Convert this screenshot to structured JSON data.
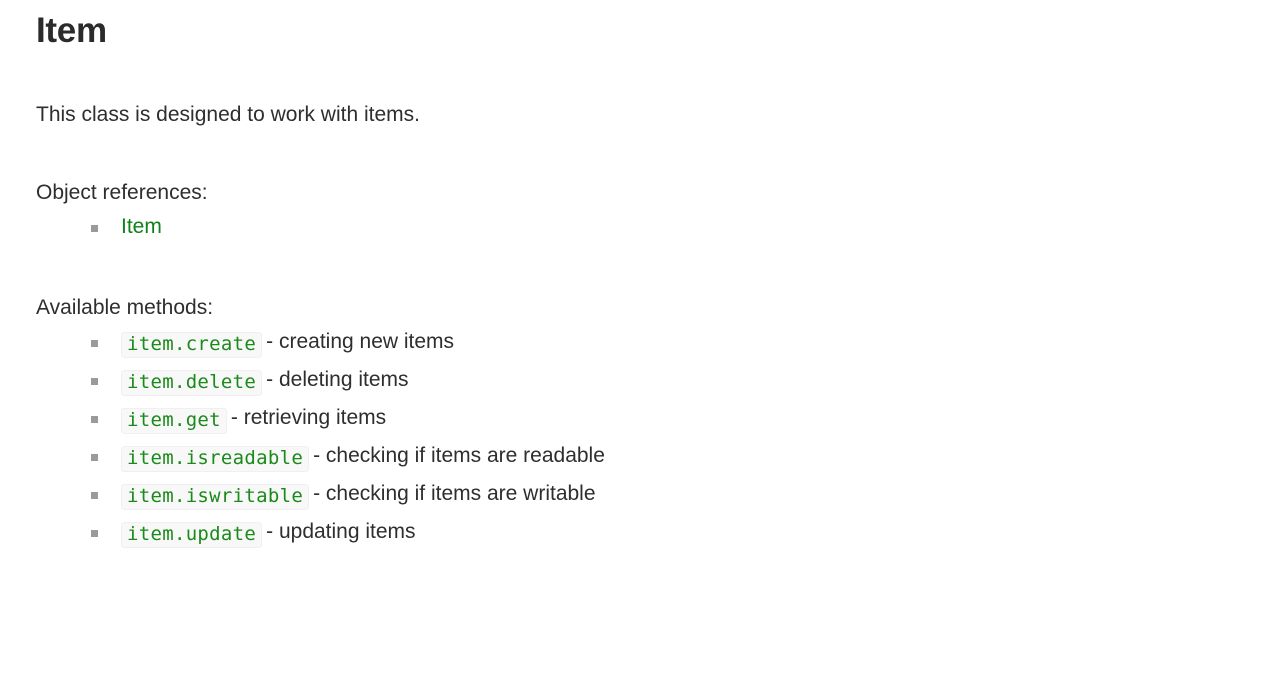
{
  "page": {
    "title": "Item",
    "intro": "This class is designed to work with items.",
    "object_references_heading": "Object references:",
    "available_methods_heading": "Available methods:"
  },
  "colors": {
    "link_green": "#12801a",
    "code_green": "#1a8a1a",
    "code_background": "#f8f8f8",
    "code_border": "#f0f0f0",
    "bullet_marker": "#9a9a9a",
    "text": "#2e2e2e",
    "heading": "#2b2b2b",
    "page_background": "#ffffff"
  },
  "object_references": [
    {
      "label": "Item"
    }
  ],
  "methods": [
    {
      "code": "item.create",
      "description": "- creating new items"
    },
    {
      "code": "item.delete",
      "description": "- deleting items"
    },
    {
      "code": "item.get",
      "description": "- retrieving items"
    },
    {
      "code": "item.isreadable",
      "description": "- checking if items are readable"
    },
    {
      "code": "item.iswritable",
      "description": "- checking if items are writable"
    },
    {
      "code": "item.update",
      "description": "- updating items"
    }
  ]
}
